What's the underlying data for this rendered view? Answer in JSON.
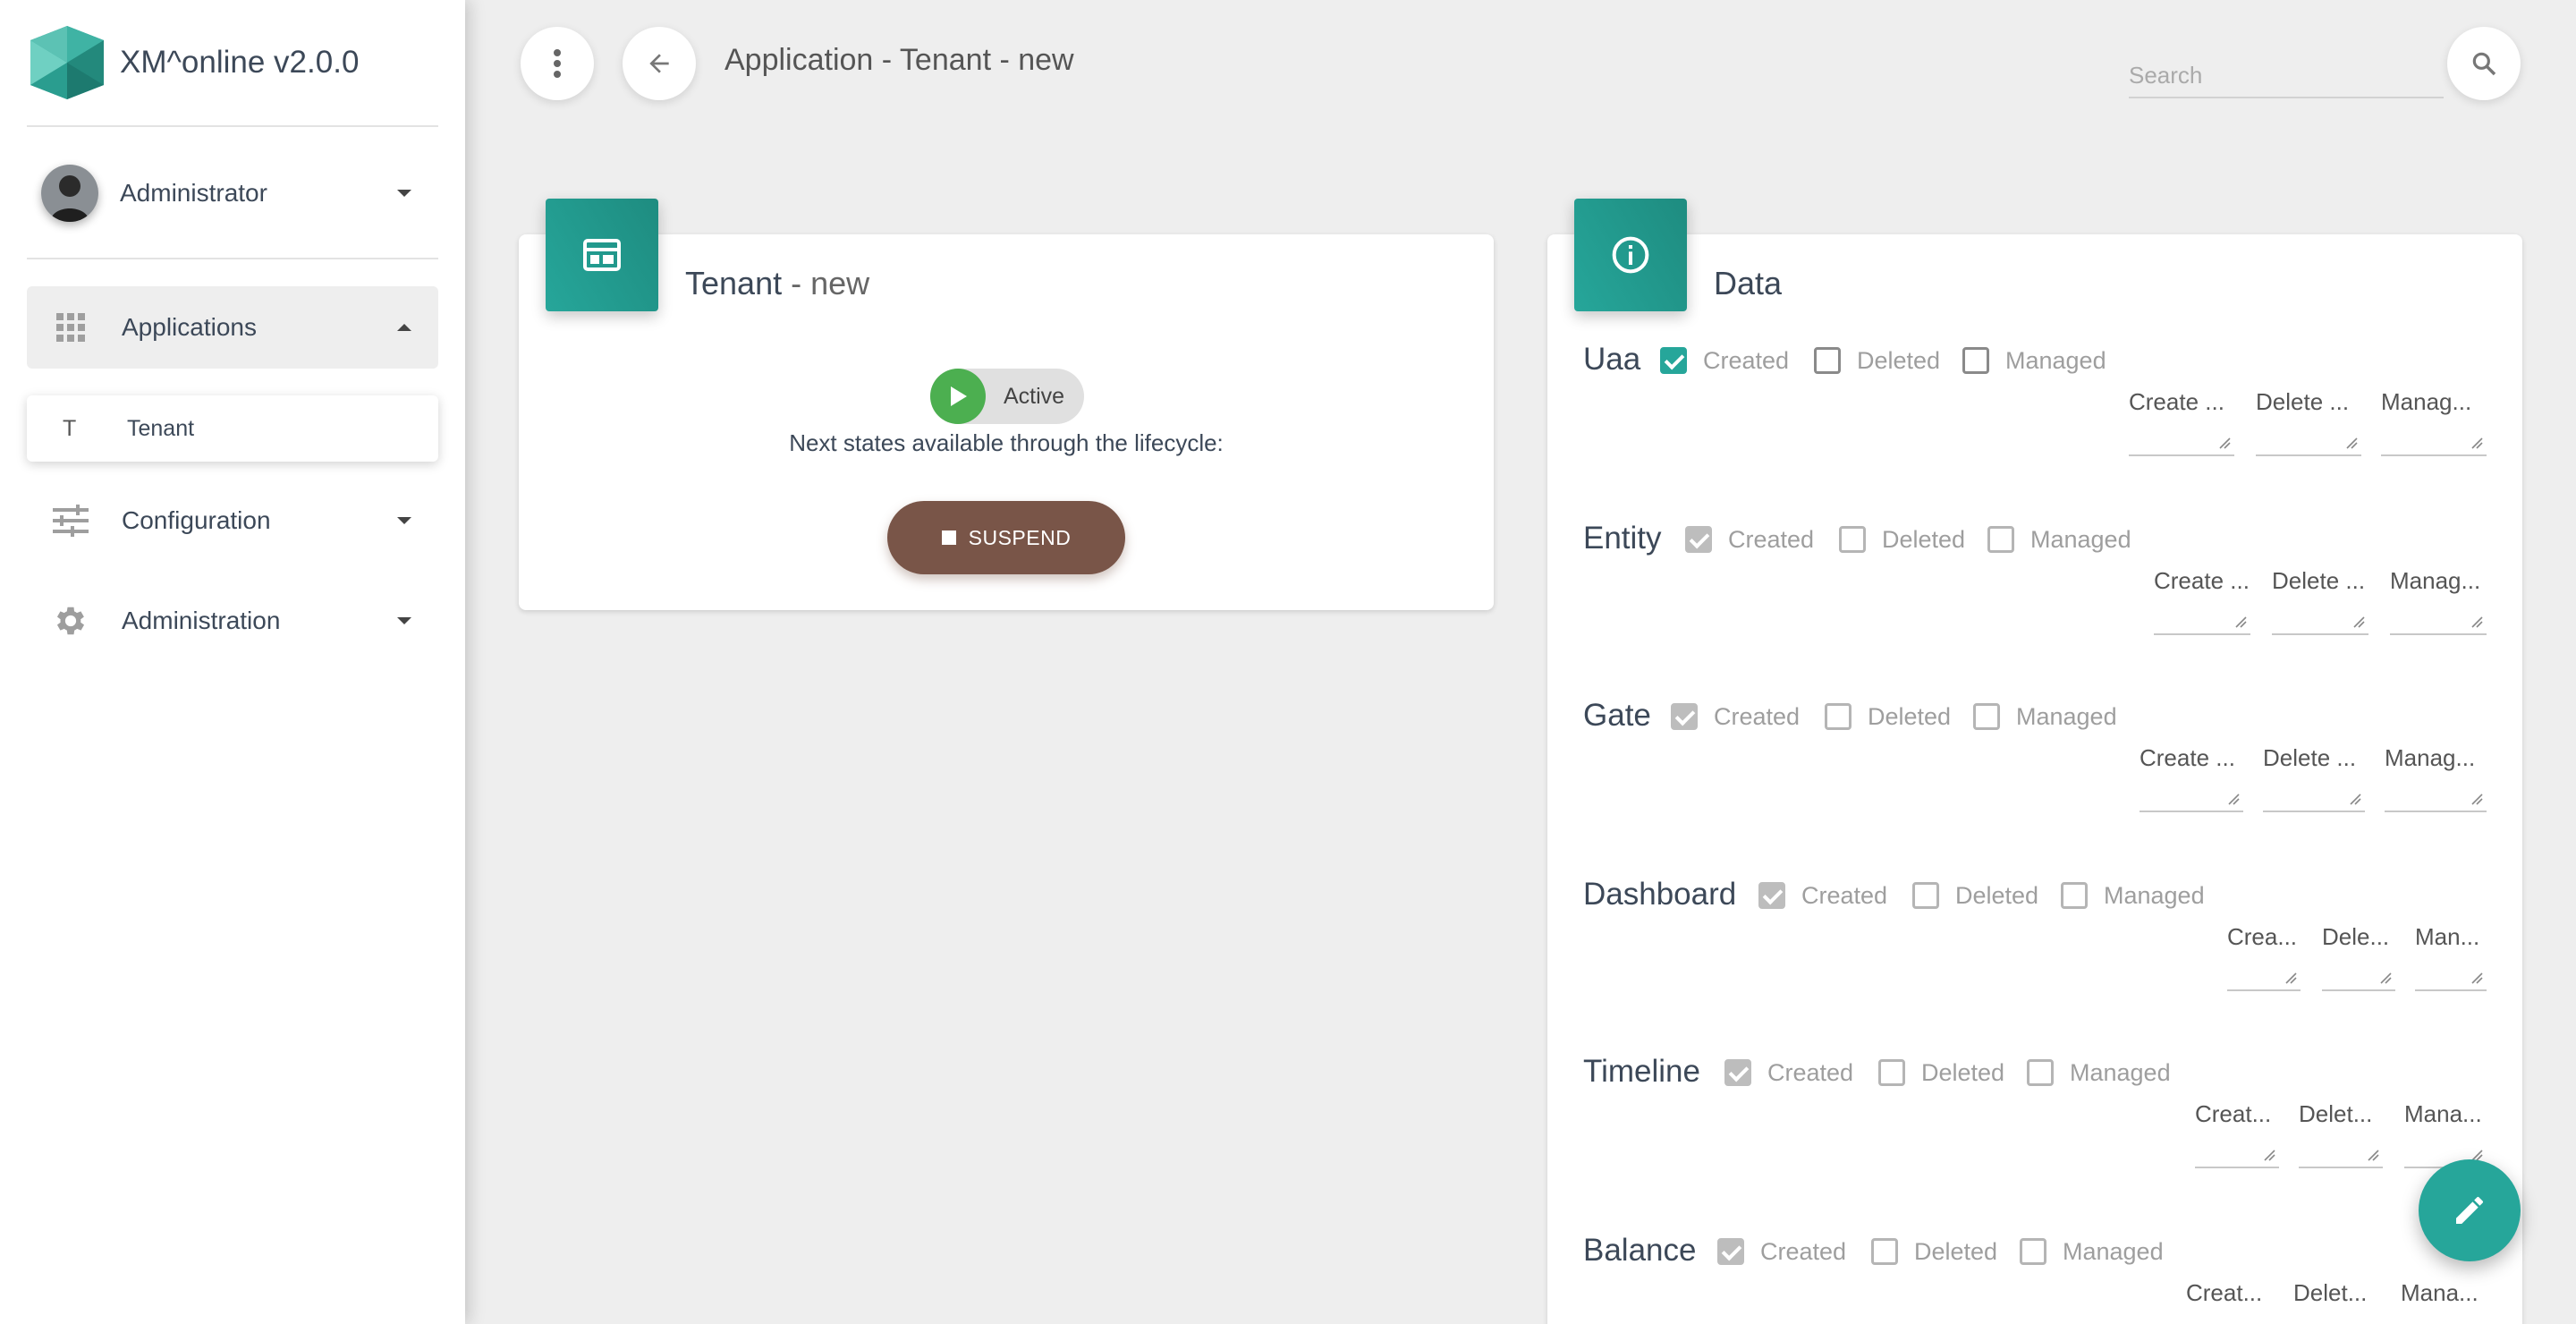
{
  "app": {
    "title": "XM^online v2.0.0"
  },
  "user": {
    "name": "Administrator"
  },
  "sidebar": {
    "items": [
      {
        "label": "Applications",
        "icon": "grid-icon"
      },
      {
        "label": "Configuration",
        "icon": "tune-icon"
      },
      {
        "label": "Administration",
        "icon": "gear-icon"
      }
    ],
    "subitem": {
      "mini": "T",
      "label": "Tenant"
    }
  },
  "header": {
    "title": "Application - Tenant - new",
    "search_placeholder": "Search"
  },
  "tenant_card": {
    "title_main": "Tenant",
    "title_suffix": " - new",
    "status": "Active",
    "lifecycle_text": "Next states available through the lifecycle:",
    "action_label": "SUSPEND"
  },
  "data_card": {
    "title": "Data",
    "checkbox_labels": {
      "created": "Created",
      "deleted": "Deleted",
      "managed": "Managed"
    },
    "rows": [
      {
        "name": "Uaa",
        "created": true,
        "deleted": false,
        "managed": false,
        "fields": [
          "Create ...",
          "Delete ...",
          "Manag..."
        ]
      },
      {
        "name": "Entity",
        "created": true,
        "deleted": false,
        "managed": false,
        "fields": [
          "Create ...",
          "Delete ...",
          "Manag..."
        ]
      },
      {
        "name": "Gate",
        "created": true,
        "deleted": false,
        "managed": false,
        "fields": [
          "Create ...",
          "Delete ...",
          "Manag..."
        ]
      },
      {
        "name": "Dashboard",
        "created": true,
        "deleted": false,
        "managed": false,
        "fields": [
          "Crea...",
          "Dele...",
          "Man..."
        ]
      },
      {
        "name": "Timeline",
        "created": true,
        "deleted": false,
        "managed": false,
        "fields": [
          "Creat...",
          "Delet...",
          "Mana..."
        ]
      },
      {
        "name": "Balance",
        "created": true,
        "deleted": false,
        "managed": false,
        "fields": [
          "Creat...",
          "Delet...",
          "Mana..."
        ]
      }
    ]
  },
  "colors": {
    "accent": "#26a69a",
    "suspend": "#795548",
    "active": "#4caf50",
    "background": "#eeeeee"
  }
}
